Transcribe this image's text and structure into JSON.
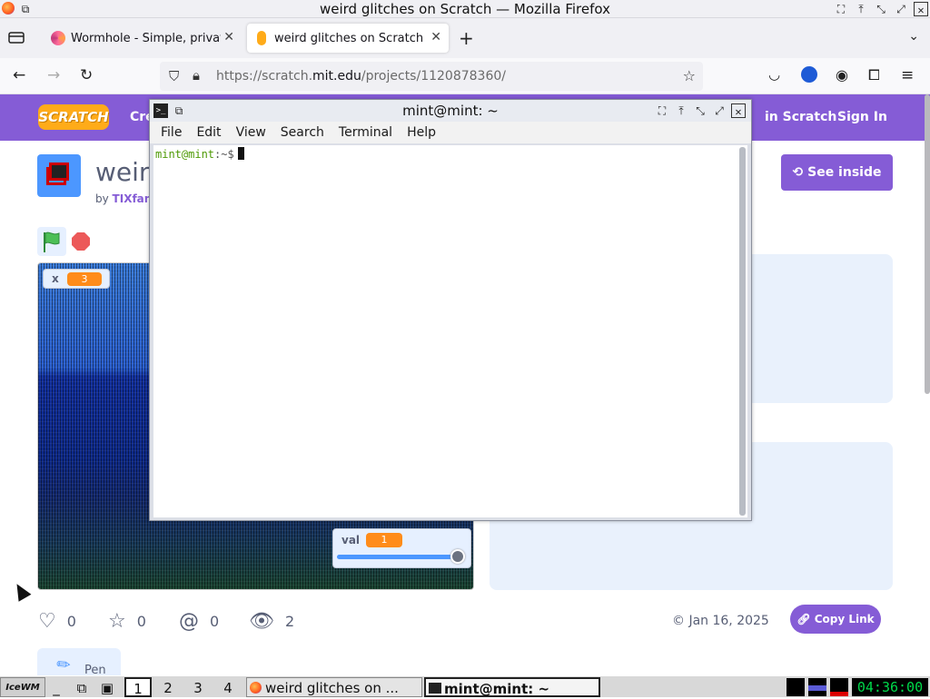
{
  "browser": {
    "window_title": "weird glitches on Scratch — Mozilla Firefox",
    "tabs": [
      {
        "label": "Wormhole - Simple, privat",
        "active": false
      },
      {
        "label": "weird glitches on Scratch",
        "active": true
      }
    ],
    "url_prefix": "https://scratch.",
    "url_domain": "mit.edu",
    "url_path": "/projects/1120878360/"
  },
  "scratch": {
    "logo": "SCRATCH",
    "nav_left": "Cre",
    "nav_join": "in Scratch",
    "nav_signin": "Sign In",
    "title": "weirc",
    "by": "by",
    "author": "TIXfan:",
    "see_inside": "See inside",
    "var_x": {
      "name": "x",
      "value": "3"
    },
    "var_val": {
      "name": "val",
      "value": "1",
      "slider_fraction": 0.95
    },
    "stats": {
      "loves": "0",
      "favorites": "0",
      "remixes": "0",
      "views": "2"
    },
    "date": "Jan 16, 2025",
    "copy_link": "Copy Link",
    "extension": "Pen"
  },
  "terminal": {
    "title": "mint@mint: ~",
    "menu": [
      "File",
      "Edit",
      "View",
      "Search",
      "Terminal",
      "Help"
    ],
    "prompt_user": "mint@mint",
    "prompt_path": ":~$"
  },
  "taskbar": {
    "logo": "IceWM",
    "workspaces": [
      "1",
      "2",
      "3",
      "4"
    ],
    "firefox_task": "weird glitches on ...",
    "terminal_task": "mint@mint: ~",
    "clock": "04:36:00"
  },
  "colors": {
    "scratch_purple": "#855cd6",
    "scratch_orange": "#ff8c1a",
    "terminal_prompt_green": "#4e9a06",
    "clock_green": "#00d84a"
  }
}
